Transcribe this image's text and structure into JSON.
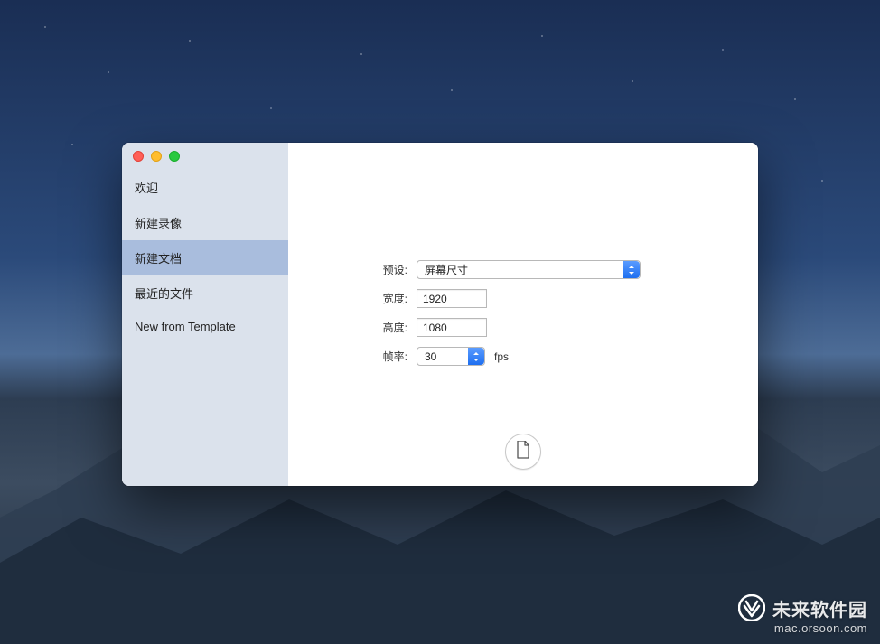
{
  "sidebar": {
    "items": [
      {
        "label": "欢迎"
      },
      {
        "label": "新建录像"
      },
      {
        "label": "新建文档"
      },
      {
        "label": "最近的文件"
      },
      {
        "label": "New from Template"
      }
    ],
    "selected_index": 2
  },
  "form": {
    "preset": {
      "label": "预设:",
      "value": "屏幕尺寸"
    },
    "width": {
      "label": "宽度:",
      "value": "1920"
    },
    "height": {
      "label": "高度:",
      "value": "1080"
    },
    "fps": {
      "label": "帧率:",
      "value": "30",
      "unit": "fps"
    }
  },
  "watermark": {
    "title": "未来软件园",
    "url": "mac.orsoon.com"
  }
}
